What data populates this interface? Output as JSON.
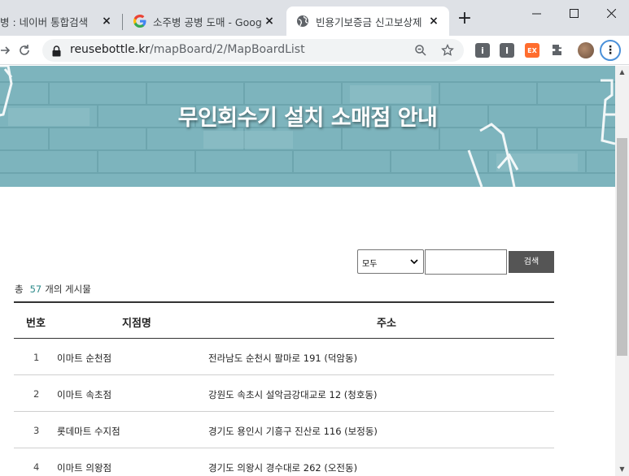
{
  "browser": {
    "tabs": [
      {
        "title": "병 : 네이버 통합검색",
        "close": "×"
      },
      {
        "title": "소주병 공병 도매 - Goog",
        "close": "×"
      },
      {
        "title": "빈용기보증금 신고보상제",
        "close": "×"
      }
    ],
    "new_tab": "+",
    "window": {
      "minimize": "—",
      "maximize": "☐",
      "close": "✕"
    },
    "url_domain": "reusebottle.kr",
    "url_path": "/mapBoard/2/MapBoardList",
    "menu": "⋮"
  },
  "page": {
    "banner_title": "무인회수기 설치 소매점 안내",
    "search": {
      "select_value": "모두",
      "input_value": "",
      "button_label": "검색"
    },
    "total": {
      "prefix": "총",
      "count": "57",
      "suffix": "개의 게시물"
    },
    "table": {
      "headers": {
        "no": "번호",
        "name": "지점명",
        "address": "주소"
      },
      "rows": [
        {
          "no": "1",
          "name": "이마트 순천점",
          "address": "전라남도 순천시 팔마로 191 (덕암동)"
        },
        {
          "no": "2",
          "name": "이마트 속초점",
          "address": "강원도 속초시 설악금강대교로 12 (청호동)"
        },
        {
          "no": "3",
          "name": "롯데마트 수지점",
          "address": "경기도 용인시 기흥구 진산로 116 (보정동)"
        },
        {
          "no": "4",
          "name": "이마트 의왕점",
          "address": "경기도 의왕시 경수대로 262 (오전동)"
        }
      ]
    }
  },
  "colors": {
    "banner": "#7fb7c0",
    "count_accent": "#2e8b8b",
    "search_button": "#555555"
  }
}
